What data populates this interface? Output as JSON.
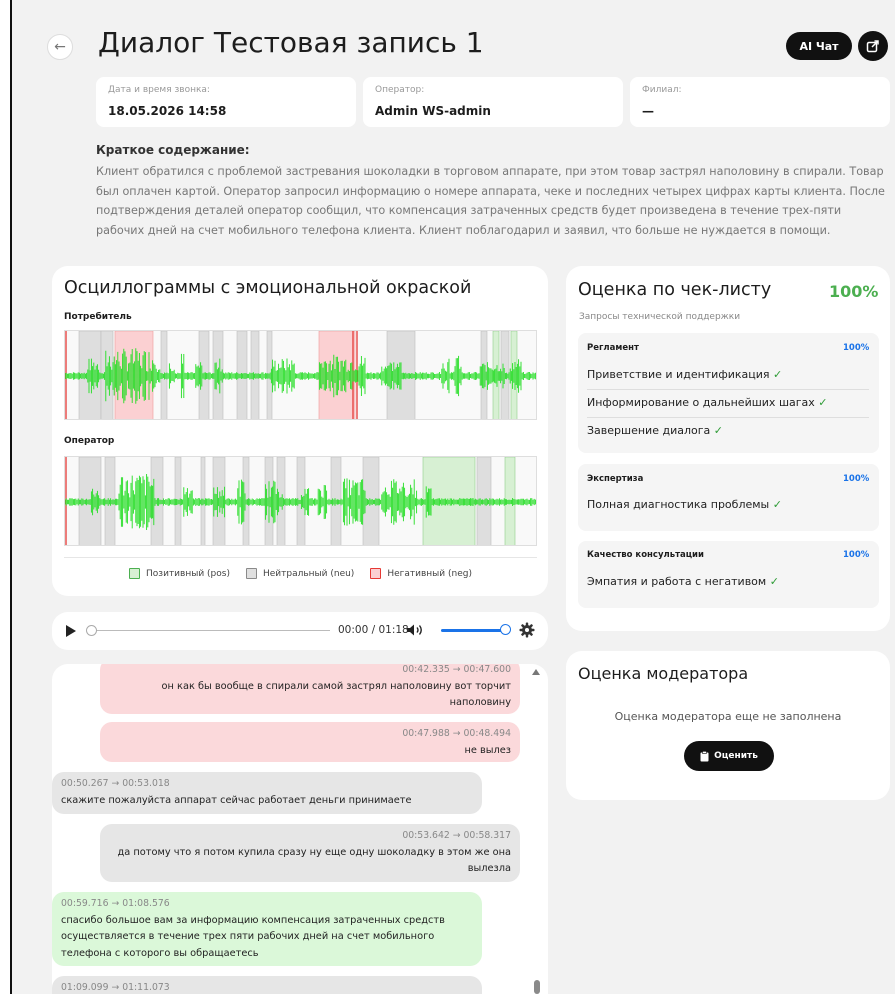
{
  "header": {
    "title": "Диалог Тестовая запись 1",
    "ai_chat_label": "AI Чат",
    "back_icon": "arrow-left-icon",
    "share_icon": "share-icon"
  },
  "info": {
    "datetime_label": "Дата и время звонка:",
    "datetime_value": "18.05.2026 14:58",
    "operator_label": "Оператор:",
    "operator_value": "Admin WS-admin",
    "branch_label": "Филиал:",
    "branch_value": "—"
  },
  "summary": {
    "heading": "Краткое содержание:",
    "text": "Клиент обратился с проблемой застревания шоколадки в торговом аппарате, при этом товар застрял наполовину в спирали. Товар был оплачен картой. Оператор запросил информацию о номере аппарата, чеке и последних четырех цифрах карты клиента. После подтверждения деталей оператор сообщил, что компенсация затраченных средств будет произведена в течение трех-пяти рабочих дней на счет мобильного телефона клиента. Клиент поблагодарил и заявил, что больше не нуждается в помощи."
  },
  "oscillogram": {
    "title": "Осциллограммы с эмоциональной окраской",
    "consumer_label": "Потребитель",
    "operator_label": "Оператор",
    "legend": {
      "pos": "Позитивный (pos)",
      "neu": "Нейтральный (neu)",
      "neg": "Негативный (neg)"
    },
    "colors": {
      "pos": "#4caf50",
      "neu": "#9e9e9e",
      "neg": "#e53935",
      "wave": "#22dd22"
    }
  },
  "player": {
    "time": "00:00 / 01:18",
    "play_icon": "play-icon",
    "volume_icon": "volume-icon",
    "settings_icon": "gear-icon",
    "volume_level": 0.85
  },
  "chat": {
    "messages": [
      {
        "ts": "00:42.335 → 00:47.600",
        "text": "он как бы вообще в спирали самой застрял наполовину вот торчит наполовину",
        "tone": "neg"
      },
      {
        "ts": "00:47.988 → 00:48.494",
        "text": "не вылез",
        "tone": "neg"
      },
      {
        "ts": "00:50.267 → 00:53.018",
        "text": "скажите пожалуйста аппарат сейчас работает деньги принимаете",
        "tone": "neu"
      },
      {
        "ts": "00:53.642 → 00:58.317",
        "text": "да потому что я потом купила сразу ну еще одну шоколадку в этом же она вылезла",
        "tone": "neu"
      },
      {
        "ts": "00:59.716 → 01:08.576",
        "text": "спасибо большое вам за информацию компенсация затраченных средств осуществляется в течение трех пяти рабочих дней на счет мобильного телефона с которого вы обращаетесь",
        "tone": "pos"
      },
      {
        "ts": "01:09.099 → 01:11.073",
        "text": "",
        "tone": "neu"
      }
    ]
  },
  "checklist": {
    "title": "Оценка по чек-листу",
    "percent": "100%",
    "subtitle": "Запросы технической поддержки",
    "groups": [
      {
        "label": "Регламент",
        "percent": "100%",
        "items": [
          "Приветствие и идентификация",
          "Информирование о дальнейших шагах",
          "Завершение диалога"
        ]
      },
      {
        "label": "Экспертиза",
        "percent": "100%",
        "items": [
          "Полная диагностика проблемы"
        ]
      },
      {
        "label": "Качество консультации",
        "percent": "100%",
        "items": [
          "Эмпатия и работа с негативом"
        ]
      }
    ],
    "check_mark": "✓"
  },
  "moderator": {
    "title": "Оценка модератора",
    "empty_text": "Оценка модератора еще не заполнена",
    "rate_label": "Оценить",
    "rate_icon": "clipboard-icon"
  }
}
